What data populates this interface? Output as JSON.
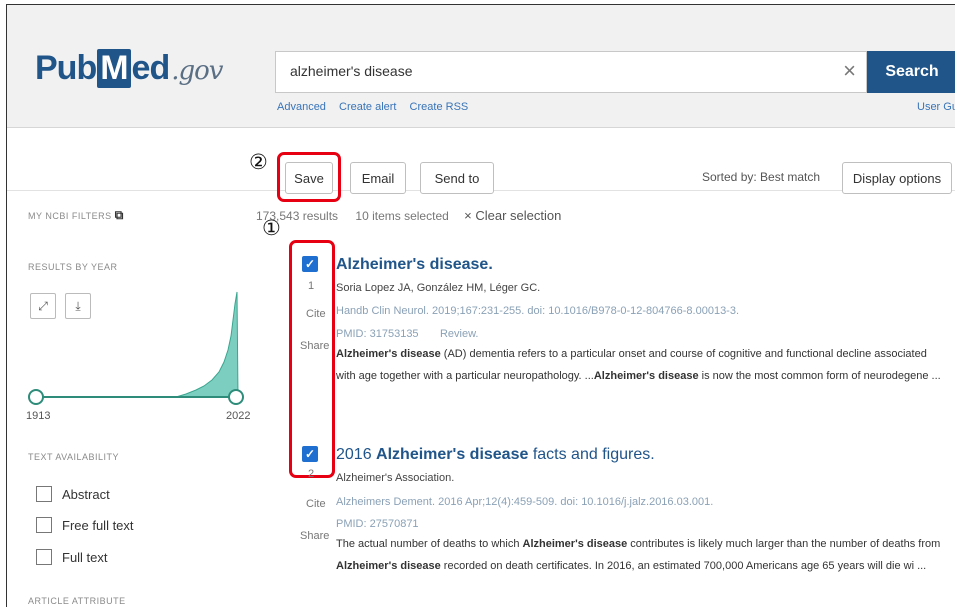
{
  "header": {
    "logo_pub": "Pub",
    "logo_m": "M",
    "logo_ed": "ed",
    "logo_gov": ".gov",
    "search_value": "alzheimer's disease",
    "search_button": "Search",
    "links": [
      "Advanced",
      "Create alert",
      "Create RSS"
    ],
    "user_guide": "User Guid"
  },
  "toolbar": {
    "save_label": "Save",
    "email_label": "Email",
    "send_to_label": "Send to",
    "sorted_by": "Sorted by: Best match",
    "display_options": "Display options"
  },
  "annotations": {
    "one": "①",
    "two": "②"
  },
  "sidebar": {
    "my_ncbi_filters": "MY NCBI FILTERS",
    "results_by_year": "RESULTS BY YEAR",
    "year_start": "1913",
    "year_end": "2022",
    "text_availability": "TEXT AVAILABILITY",
    "filters": [
      "Abstract",
      "Free full text",
      "Full text"
    ],
    "article_attribute": "ARTICLE ATTRIBUTE"
  },
  "results_meta": {
    "count": "173,543 results",
    "selected": "10 items selected",
    "clear": "× Clear selection"
  },
  "results": [
    {
      "num": "1",
      "title": "Alzheimer's disease.",
      "authors": "Soria Lopez JA, González HM, Léger GC.",
      "journal": "Handb Clin Neurol. 2019;167:231-255. doi: 10.1016/B978-0-12-804766-8.00013-3.",
      "pmid": "PMID: 31753135",
      "type": "Review.",
      "snippet_bold_1": "Alzheimer's disease",
      "snippet_1": " (AD) dementia refers to a particular onset and course of cognitive and functional decline associated with age together with a particular neuropathology. ...",
      "snippet_bold_2": "Alzheimer's disease",
      "snippet_2": " is now the most common form of neurodegene ...",
      "cite": "Cite",
      "share": "Share"
    },
    {
      "num": "2",
      "title_prefix": "2016 ",
      "title_bold": "Alzheimer's disease",
      "title_suffix": " facts and figures.",
      "authors": "Alzheimer's Association.",
      "journal": "Alzheimers Dement. 2016 Apr;12(4):459-509. doi: 10.1016/j.jalz.2016.03.001.",
      "pmid": "PMID: 27570871",
      "snippet_a": "The actual number of deaths to which ",
      "snippet_bold_1": "Alzheimer's disease",
      "snippet_b": " contributes is likely much larger than the number of deaths from ",
      "snippet_bold_2": "Alzheimer's disease",
      "snippet_c": " recorded on death certificates. In 2016, an estimated 700,000 Americans age 65 years will die wi ...",
      "cite": "Cite",
      "share": "Share"
    }
  ]
}
